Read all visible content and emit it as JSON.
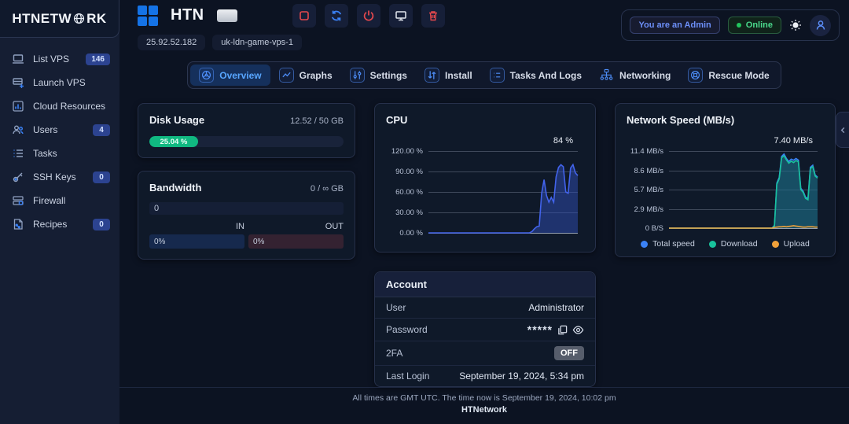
{
  "sidebar": {
    "brand_prefix": "HTNETW",
    "brand_suffix": "RK",
    "items": [
      {
        "label": "List VPS",
        "badge": "146",
        "icon": "laptop-icon"
      },
      {
        "label": "Launch VPS",
        "badge": null,
        "icon": "server-plus-icon"
      },
      {
        "label": "Cloud Resources",
        "badge": null,
        "icon": "bar-chart-icon"
      },
      {
        "label": "Users",
        "badge": "4",
        "icon": "users-icon"
      },
      {
        "label": "Tasks",
        "badge": null,
        "icon": "task-list-icon"
      },
      {
        "label": "SSH Keys",
        "badge": "0",
        "icon": "key-icon"
      },
      {
        "label": "Firewall",
        "badge": null,
        "icon": "firewall-icon"
      },
      {
        "label": "Recipes",
        "badge": "0",
        "icon": "recipe-icon"
      }
    ]
  },
  "topbar": {
    "server_name": "HTN",
    "admin_badge": "You are an Admin",
    "online_badge": "Online",
    "ip": "25.92.52.182",
    "hostname": "uk-ldn-game-vps-1"
  },
  "tabs": [
    {
      "label": "Overview",
      "icon": "overview-icon",
      "active": true,
      "no_box": false
    },
    {
      "label": "Graphs",
      "icon": "graphs-icon",
      "active": false,
      "no_box": false
    },
    {
      "label": "Settings",
      "icon": "settings-icon",
      "active": false,
      "no_box": false
    },
    {
      "label": "Install",
      "icon": "install-icon",
      "active": false,
      "no_box": false
    },
    {
      "label": "Tasks And Logs",
      "icon": "tasks-logs-icon",
      "active": false,
      "no_box": false
    },
    {
      "label": "Networking",
      "icon": "networking-icon",
      "active": false,
      "no_box": true
    },
    {
      "label": "Rescue Mode",
      "icon": "rescue-icon",
      "active": false,
      "no_box": false
    }
  ],
  "cards": {
    "disk": {
      "title": "Disk Usage",
      "value": "12.52 / 50 GB",
      "percent": 25.04,
      "percent_label": "25.04 %",
      "color": "#10b981"
    },
    "bandwidth": {
      "title": "Bandwidth",
      "value": "0 / ∞ GB",
      "total_label": "0",
      "in_label": "IN",
      "out_label": "OUT",
      "in_value": "0%",
      "out_value": "0%"
    },
    "account": {
      "title": "Account",
      "user_label": "User",
      "user_value": "Administrator",
      "password_label": "Password",
      "password_value": "*****",
      "twofa_label": "2FA",
      "twofa_value": "OFF",
      "last_login_label": "Last Login",
      "last_login_value": "September 19, 2024, 5:34 pm"
    }
  },
  "chart_data": [
    {
      "type": "area",
      "title": "CPU",
      "current_value": "84 %",
      "ylabel_ticks": [
        "120.00 %",
        "90.00 %",
        "60.00 %",
        "30.00 %",
        "0.00 %"
      ],
      "ymax": 120,
      "grid": true,
      "series": [
        {
          "name": "cpu-usage",
          "color": "#4263eb",
          "fill": "rgba(48,78,180,0.5)",
          "values": [
            0,
            0,
            0,
            0,
            0,
            0,
            0,
            0,
            0,
            0,
            0,
            0,
            0,
            0,
            0,
            0,
            0,
            0,
            0,
            0,
            0,
            0,
            0,
            0,
            0,
            0,
            0,
            0,
            0,
            0,
            0,
            0,
            0,
            0,
            0,
            0,
            0,
            0,
            0,
            0,
            0,
            0,
            0,
            2,
            6,
            9,
            10,
            58,
            78,
            55,
            45,
            52,
            45,
            82,
            96,
            100,
            97,
            60,
            58,
            95,
            100,
            88,
            84
          ]
        }
      ]
    },
    {
      "type": "area",
      "title": "Network Speed (MB/s)",
      "current_value": "7.40 MB/s",
      "ylabel_ticks": [
        "11.4 MB/s",
        "8.6 MB/s",
        "5.7 MB/s",
        "2.9 MB/s",
        "0 B/S"
      ],
      "ymax": 11.4,
      "grid": true,
      "legend": [
        {
          "name": "Total speed",
          "color": "#3b82f6"
        },
        {
          "name": "Download",
          "color": "#18c29c"
        },
        {
          "name": "Upload",
          "color": "#f0a13a"
        }
      ],
      "series": [
        {
          "name": "total-speed",
          "color": "#3b82f6",
          "fill": "rgba(59,130,246,0.25)",
          "values": [
            0,
            0,
            0,
            0,
            0,
            0,
            0,
            0,
            0,
            0,
            0,
            0,
            0,
            0,
            0,
            0,
            0,
            0,
            0,
            0,
            0,
            0,
            0,
            0,
            0,
            0,
            0,
            0,
            0,
            0,
            0,
            0,
            0,
            0,
            0,
            0,
            0,
            0,
            0,
            0,
            0,
            0,
            0,
            0,
            0.4,
            6.65,
            7.5,
            10.6,
            10.95,
            10.3,
            9.85,
            10.2,
            10.05,
            10.3,
            10.05,
            5.9,
            5.45,
            4.55,
            4.4,
            9.0,
            9.3,
            7.85,
            7.55
          ]
        },
        {
          "name": "download",
          "color": "#18c29c",
          "fill": "rgba(20,110,110,0.45)",
          "values": [
            0,
            0,
            0,
            0,
            0,
            0,
            0,
            0,
            0,
            0,
            0,
            0,
            0,
            0,
            0,
            0,
            0,
            0,
            0,
            0,
            0,
            0,
            0,
            0,
            0,
            0,
            0,
            0,
            0,
            0,
            0,
            0,
            0,
            0,
            0,
            0,
            0,
            0,
            0,
            0,
            0,
            0,
            0,
            0,
            0.3,
            6.5,
            7.3,
            10.4,
            10.7,
            10.1,
            9.6,
            9.9,
            9.7,
            10.0,
            9.8,
            5.7,
            5.3,
            4.4,
            4.2,
            8.8,
            9.1,
            7.7,
            7.4
          ]
        },
        {
          "name": "upload",
          "color": "#f0a13a",
          "fill": "none",
          "values": [
            0,
            0,
            0,
            0,
            0,
            0,
            0,
            0,
            0,
            0,
            0,
            0,
            0,
            0,
            0,
            0,
            0,
            0,
            0,
            0,
            0,
            0,
            0,
            0,
            0,
            0,
            0,
            0,
            0,
            0,
            0,
            0,
            0,
            0,
            0,
            0,
            0,
            0,
            0,
            0,
            0,
            0,
            0,
            0,
            0.1,
            0.15,
            0.2,
            0.2,
            0.25,
            0.2,
            0.25,
            0.3,
            0.35,
            0.3,
            0.25,
            0.2,
            0.15,
            0.15,
            0.2,
            0.2,
            0.2,
            0.15,
            0.15
          ]
        }
      ]
    }
  ],
  "footer": {
    "line1": "All times are GMT UTC. The time now is September 19, 2024, 10:02 pm",
    "line2": "HTNetwork"
  }
}
